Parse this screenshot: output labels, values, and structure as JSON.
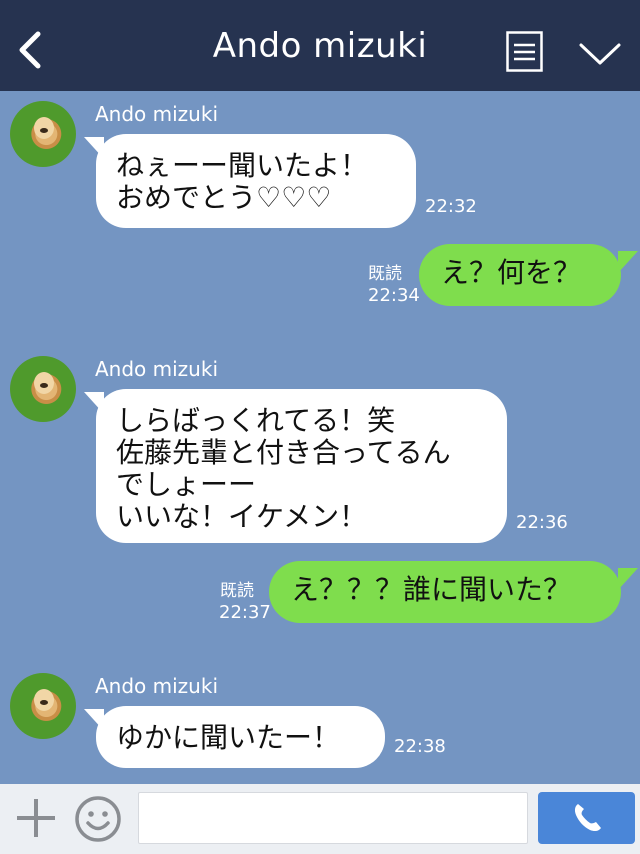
{
  "header": {
    "title": "Ando mizuki"
  },
  "messages": [
    {
      "direction": "in",
      "sender": "Ando mizuki",
      "text": "ねぇーー聞いたよ！\nおめでとう♡♡♡",
      "time": "22:32"
    },
    {
      "direction": "out",
      "text": "え？何を？",
      "status": "既読",
      "time": "22:34"
    },
    {
      "direction": "in",
      "sender": "Ando mizuki",
      "text": "しらばっくれてる！笑\n佐藤先輩と付き合ってるん\nでしょーー\nいいな！イケメン！",
      "time": "22:36"
    },
    {
      "direction": "out",
      "text": "え？？？誰に聞いた？",
      "status": "既読",
      "time": "22:37"
    },
    {
      "direction": "in",
      "sender": "Ando mizuki",
      "text": "ゆかに聞いたー！",
      "time": "22:38"
    }
  ],
  "footer": {
    "input_value": "",
    "input_placeholder": ""
  },
  "colors": {
    "header_bg": "#263350",
    "chat_bg": "#7495c2",
    "incoming_bubble": "#ffffff",
    "outgoing_bubble": "#7fdd4d",
    "send_button": "#4a86d8"
  }
}
